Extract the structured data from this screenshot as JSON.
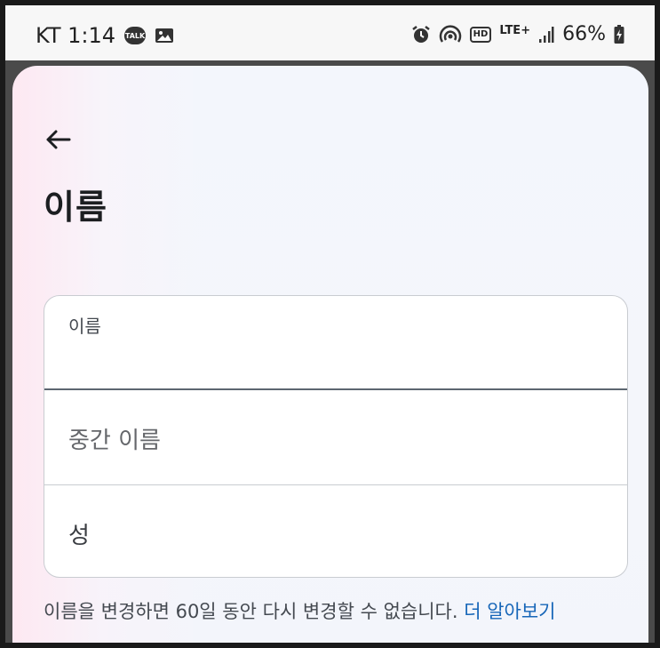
{
  "status_bar": {
    "carrier_time": "KT 1:14",
    "talk_icon_text": "TALK",
    "hd_badge": "HD",
    "network": "LTE+",
    "battery": "66%"
  },
  "header": {
    "title": "이름"
  },
  "form": {
    "first_name": {
      "label": "이름",
      "value": ""
    },
    "middle_name": {
      "placeholder": "중간 이름"
    },
    "last_name": {
      "placeholder": "성"
    }
  },
  "notice": {
    "text": "이름을 변경하면 60일 동안 다시 변경할 수 없습니다. ",
    "link": "더 알아보기"
  },
  "colors": {
    "link": "#1766b8",
    "text": "#1c1e21",
    "field_border": "#c9ccd1"
  }
}
